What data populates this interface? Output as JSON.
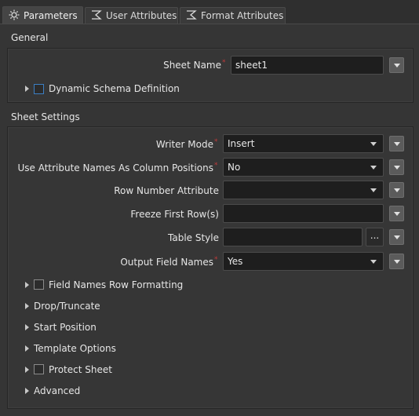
{
  "tabs": [
    {
      "label": "Parameters",
      "icon": "gear-icon",
      "active": true
    },
    {
      "label": "User Attributes",
      "icon": "sigma-icon",
      "active": false
    },
    {
      "label": "Format Attributes",
      "icon": "sigma-icon",
      "active": false
    }
  ],
  "general": {
    "title": "General",
    "sheet_name": {
      "label": "Sheet Name",
      "value": "sheet1",
      "required": true
    },
    "dynamic_schema": {
      "label": "Dynamic Schema Definition",
      "checked": false
    }
  },
  "sheet_settings": {
    "title": "Sheet Settings",
    "writer_mode": {
      "label": "Writer Mode",
      "value": "Insert",
      "required": true
    },
    "use_attr_names": {
      "label": "Use Attribute Names As Column Positions",
      "value": "No",
      "required": true
    },
    "row_number_attr": {
      "label": "Row Number Attribute",
      "value": ""
    },
    "freeze_first_rows": {
      "label": "Freeze First Row(s)",
      "value": ""
    },
    "table_style": {
      "label": "Table Style",
      "value": "",
      "ellipsis": "..."
    },
    "output_field_names": {
      "label": "Output Field Names",
      "value": "Yes",
      "required": true
    },
    "field_names_row_formatting": {
      "label": "Field Names Row Formatting",
      "checked": false
    },
    "drop_truncate": {
      "label": "Drop/Truncate"
    },
    "start_position": {
      "label": "Start Position"
    },
    "template_options": {
      "label": "Template Options"
    },
    "protect_sheet": {
      "label": "Protect Sheet",
      "checked": false
    },
    "advanced": {
      "label": "Advanced"
    }
  },
  "colors": {
    "background": "#353535",
    "field": "#1e1e1e",
    "required": "#c03a3a",
    "checkbox_focus": "#3c7fc4"
  }
}
